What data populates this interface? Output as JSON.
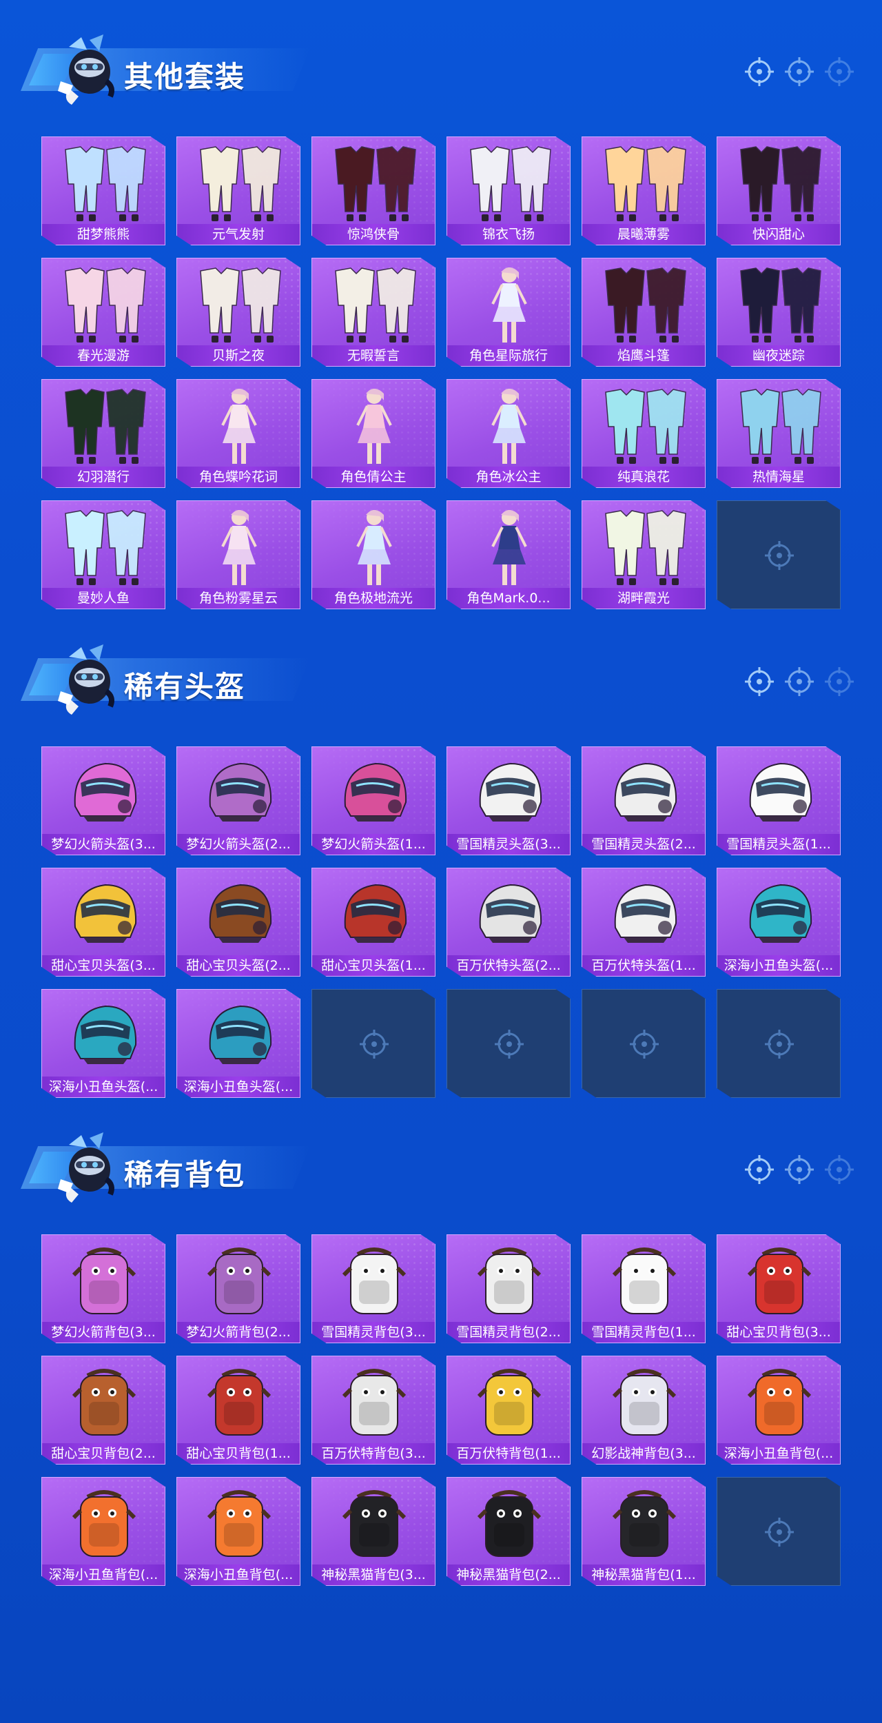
{
  "colors": {
    "background": "#0a55d8",
    "card_purple": "#a35cee",
    "card_label": "#8a37df",
    "empty_slot": "#1f3f73",
    "title_text": "#ffffff"
  },
  "sections": [
    {
      "title": "其他套装",
      "items": [
        {
          "label": "甜梦熊熊",
          "icon": "outfit-icon",
          "tint": "#bfe0ff"
        },
        {
          "label": "元气发射",
          "icon": "outfit-icon",
          "tint": "#f4eedd"
        },
        {
          "label": "惊鸿侠骨",
          "icon": "outfit-icon",
          "tint": "#4a1a22"
        },
        {
          "label": "锦衣飞扬",
          "icon": "outfit-icon",
          "tint": "#f0f0f6"
        },
        {
          "label": "晨曦薄雾",
          "icon": "outfit-icon",
          "tint": "#ffd59a"
        },
        {
          "label": "快闪甜心",
          "icon": "outfit-icon",
          "tint": "#2a1a28"
        },
        {
          "label": "春光漫游",
          "icon": "outfit-icon",
          "tint": "#f6d6e6"
        },
        {
          "label": "贝斯之夜",
          "icon": "outfit-icon",
          "tint": "#f2ece6"
        },
        {
          "label": "无暇誓言",
          "icon": "outfit-icon",
          "tint": "#f3efe6"
        },
        {
          "label": "角色星际旅行",
          "icon": "character-icon",
          "tint": "#eef2ff"
        },
        {
          "label": "焰鹰斗篷",
          "icon": "outfit-icon",
          "tint": "#3a1a24"
        },
        {
          "label": "幽夜迷踪",
          "icon": "outfit-icon",
          "tint": "#1e1c3a"
        },
        {
          "label": "幻羽潜行",
          "icon": "outfit-icon",
          "tint": "#1d3322"
        },
        {
          "label": "角色蝶吟花词",
          "icon": "character-icon",
          "tint": "#f8e6ef"
        },
        {
          "label": "角色倩公主",
          "icon": "character-icon",
          "tint": "#f7c6dc"
        },
        {
          "label": "角色冰公主",
          "icon": "character-icon",
          "tint": "#dbeeff"
        },
        {
          "label": "纯真浪花",
          "icon": "outfit-icon",
          "tint": "#9fe6f0"
        },
        {
          "label": "热情海星",
          "icon": "outfit-icon",
          "tint": "#8fd2ee"
        },
        {
          "label": "曼妙人鱼",
          "icon": "outfit-icon",
          "tint": "#c9f0ff"
        },
        {
          "label": "角色粉雾星云",
          "icon": "character-icon",
          "tint": "#f6e2f2"
        },
        {
          "label": "角色极地流光",
          "icon": "character-icon",
          "tint": "#d8ecff"
        },
        {
          "label": "角色Mark.0...",
          "icon": "character-icon",
          "tint": "#2d3d8a"
        },
        {
          "label": "湖畔霞光",
          "icon": "outfit-icon",
          "tint": "#f1f6e4"
        }
      ],
      "empty_slots": 1
    },
    {
      "title": "稀有头盔",
      "items": [
        {
          "label": "梦幻火箭头盔(3...",
          "icon": "helmet-icon",
          "tint": "#e06ad6"
        },
        {
          "label": "梦幻火箭头盔(2...",
          "icon": "helmet-icon",
          "tint": "#b06cc8"
        },
        {
          "label": "梦幻火箭头盔(1...",
          "icon": "helmet-icon",
          "tint": "#d8509a"
        },
        {
          "label": "雪国精灵头盔(3...",
          "icon": "helmet-icon",
          "tint": "#f2f2f2"
        },
        {
          "label": "雪国精灵头盔(2...",
          "icon": "helmet-icon",
          "tint": "#eeeeee"
        },
        {
          "label": "雪国精灵头盔(1...",
          "icon": "helmet-icon",
          "tint": "#fafafa"
        },
        {
          "label": "甜心宝贝头盔(3...",
          "icon": "helmet-icon",
          "tint": "#f2c23a"
        },
        {
          "label": "甜心宝贝头盔(2...",
          "icon": "helmet-icon",
          "tint": "#8a4a22"
        },
        {
          "label": "甜心宝贝头盔(1...",
          "icon": "helmet-icon",
          "tint": "#b8352a"
        },
        {
          "label": "百万伏特头盔(2...",
          "icon": "helmet-icon",
          "tint": "#e4e4e4"
        },
        {
          "label": "百万伏特头盔(1...",
          "icon": "helmet-icon",
          "tint": "#f0f0f0"
        },
        {
          "label": "深海小丑鱼头盔(...",
          "icon": "helmet-icon",
          "tint": "#2fb5c8"
        },
        {
          "label": "深海小丑鱼头盔(...",
          "icon": "helmet-icon",
          "tint": "#2aa8c0"
        },
        {
          "label": "深海小丑鱼头盔(...",
          "icon": "helmet-icon",
          "tint": "#2c9dc0"
        }
      ],
      "empty_slots": 4
    },
    {
      "title": "稀有背包",
      "items": [
        {
          "label": "梦幻火箭背包(3...",
          "icon": "backpack-icon",
          "tint": "#d470d8"
        },
        {
          "label": "梦幻火箭背包(2...",
          "icon": "backpack-icon",
          "tint": "#a86ac4"
        },
        {
          "label": "雪国精灵背包(3...",
          "icon": "backpack-icon",
          "tint": "#f4f4f4"
        },
        {
          "label": "雪国精灵背包(2...",
          "icon": "backpack-icon",
          "tint": "#efefef"
        },
        {
          "label": "雪国精灵背包(1...",
          "icon": "backpack-icon",
          "tint": "#fafafa"
        },
        {
          "label": "甜心宝贝背包(3...",
          "icon": "backpack-icon",
          "tint": "#d8342e"
        },
        {
          "label": "甜心宝贝背包(2...",
          "icon": "backpack-icon",
          "tint": "#b8602e"
        },
        {
          "label": "甜心宝贝背包(1...",
          "icon": "backpack-icon",
          "tint": "#c4382c"
        },
        {
          "label": "百万伏特背包(3...",
          "icon": "backpack-icon",
          "tint": "#e8e8e8"
        },
        {
          "label": "百万伏特背包(1...",
          "icon": "backpack-icon",
          "tint": "#f3c73a"
        },
        {
          "label": "幻影战神背包(3...",
          "icon": "backpack-icon",
          "tint": "#e6e6f0"
        },
        {
          "label": "深海小丑鱼背包(...",
          "icon": "backpack-icon",
          "tint": "#f06a2a"
        },
        {
          "label": "深海小丑鱼背包(...",
          "icon": "backpack-icon",
          "tint": "#f2702e"
        },
        {
          "label": "深海小丑鱼背包(...",
          "icon": "backpack-icon",
          "tint": "#f57a30"
        },
        {
          "label": "神秘黑猫背包(3...",
          "icon": "backpack-icon",
          "tint": "#222226"
        },
        {
          "label": "神秘黑猫背包(2...",
          "icon": "backpack-icon",
          "tint": "#1e1e22"
        },
        {
          "label": "神秘黑猫背包(1...",
          "icon": "backpack-icon",
          "tint": "#26262a"
        }
      ],
      "empty_slots": 1
    }
  ]
}
